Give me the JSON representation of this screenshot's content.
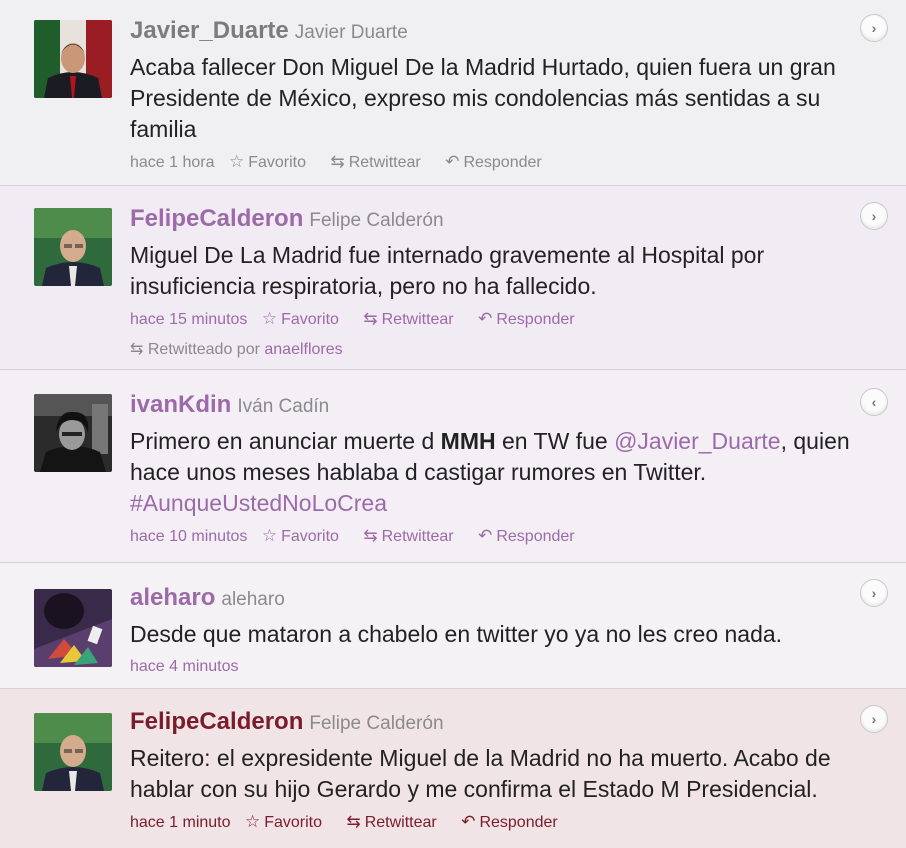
{
  "colors": {
    "accent_purple": "#9d6aa9",
    "accent_maroon": "#7a1c2b",
    "meta_grey": "#8a8a8a"
  },
  "actions": {
    "favorite": "Favorito",
    "retweet": "Retwittear",
    "reply": "Responder"
  },
  "icons": {
    "favorite": "star-icon",
    "retweet": "retweet-icon",
    "reply": "reply-arrow-icon",
    "expand": "chevron-right-icon",
    "collapse": "chevron-left-icon"
  },
  "tweets": [
    {
      "username": "Javier_Duarte",
      "fullname": "Javier Duarte",
      "text": "Acaba fallecer Don Miguel De la Madrid Hurtado, quien fuera un gran Presidente de México, expreso mis condolencias más sentidas a su familia",
      "time": "hace 1 hora"
    },
    {
      "username": "FelipeCalderon",
      "fullname": "Felipe Calderón",
      "text": "Miguel De La Madrid fue internado gravemente al Hospital por insuficiencia respiratoria, pero no ha fallecido.",
      "time": "hace 15 minutos",
      "retweeted_by_label": "Retwitteado por",
      "retweeted_by": "anaelflores"
    },
    {
      "username": "ivanKdin",
      "fullname": "Iván Cadín",
      "text_parts": {
        "a": "Primero en anunciar muerte d ",
        "b": "MMH",
        "c": " en TW fue ",
        "mention": "@Javier_Duarte",
        "d": ", quien hace unos meses hablaba d castigar rumores en Twitter. ",
        "hashtag": "#AunqueUstedNoLoCrea"
      },
      "time": "hace 10 minutos"
    },
    {
      "username": "aleharo",
      "fullname": "aleharo",
      "text": "Desde que mataron a chabelo en twitter yo ya no les creo nada.",
      "time": "hace 4 minutos"
    },
    {
      "username": "FelipeCalderon",
      "fullname": "Felipe Calderón",
      "text": "Reitero: el expresidente Miguel de la Madrid no ha muerto. Acabo de hablar con su hijo Gerardo y me confirma el Estado M Presidencial.",
      "time": "hace 1 minuto"
    }
  ]
}
